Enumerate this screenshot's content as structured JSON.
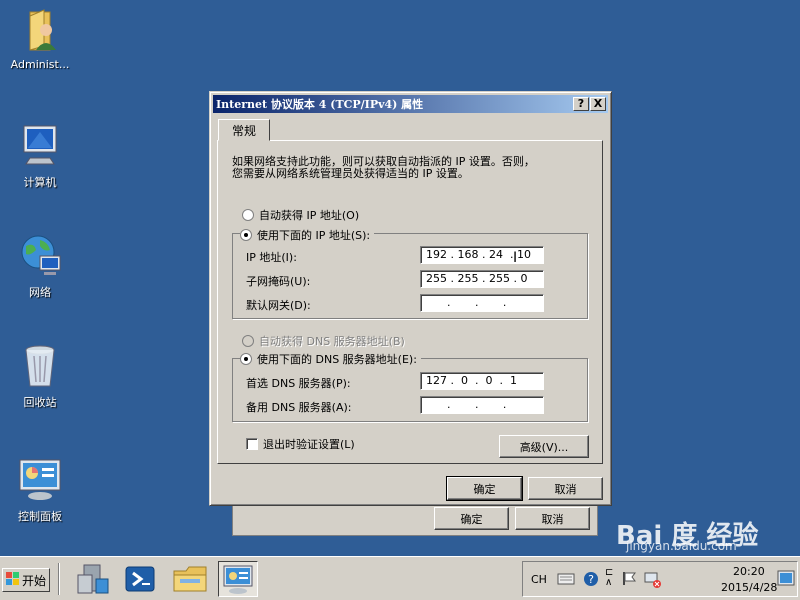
{
  "desktop": {
    "icons": [
      {
        "label": "Administ..."
      },
      {
        "label": "计算机"
      },
      {
        "label": "网络"
      },
      {
        "label": "回收站"
      },
      {
        "label": "控制面板"
      }
    ]
  },
  "dialog": {
    "title": "Internet 协议版本 4 (TCP/IPv4) 属性",
    "help_button": "?",
    "close_button": "X",
    "tab_label": "常规",
    "intro_line1": "如果网络支持此功能，则可以获取自动指派的 IP 设置。否则，",
    "intro_line2": "您需要从网络系统管理员处获得适当的 IP 设置。",
    "ip_auto_label": "自动获得 IP 地址(O)",
    "ip_manual_label": "使用下面的 IP 地址(S):",
    "ip_address_label": "IP 地址(I):",
    "ip_address_value": "192 . 168 . 24  . 10",
    "subnet_label": "子网掩码(U):",
    "subnet_value": "255 . 255 . 255 . 0",
    "gateway_label": "默认网关(D):",
    "gateway_value": "      .       .       .",
    "dns_auto_label": "自动获得 DNS 服务器地址(B)",
    "dns_manual_label": "使用下面的 DNS 服务器地址(E):",
    "dns_pref_label": "首选 DNS 服务器(P):",
    "dns_pref_value": "127 .  0  .  0  .  1",
    "dns_alt_label": "备用 DNS 服务器(A):",
    "dns_alt_value": "      .       .       .",
    "validate_label": "退出时验证设置(L)",
    "advanced_button": "高级(V)...",
    "ok_button": "确定",
    "cancel_button": "取消"
  },
  "bg_dialog": {
    "ok_button": "确定",
    "cancel_button": "取消"
  },
  "taskbar": {
    "start_label": "开始",
    "lang": "CH",
    "time": "20:20",
    "date": "2015/4/28"
  },
  "watermark": {
    "brand": "Bai 度 经验",
    "url": "jingyan.baidu.com"
  },
  "colors": {
    "desktop": "#2f5d96",
    "titlebar_start": "#0a246a",
    "titlebar_end": "#a6caf0",
    "face": "#d4d0c8"
  }
}
